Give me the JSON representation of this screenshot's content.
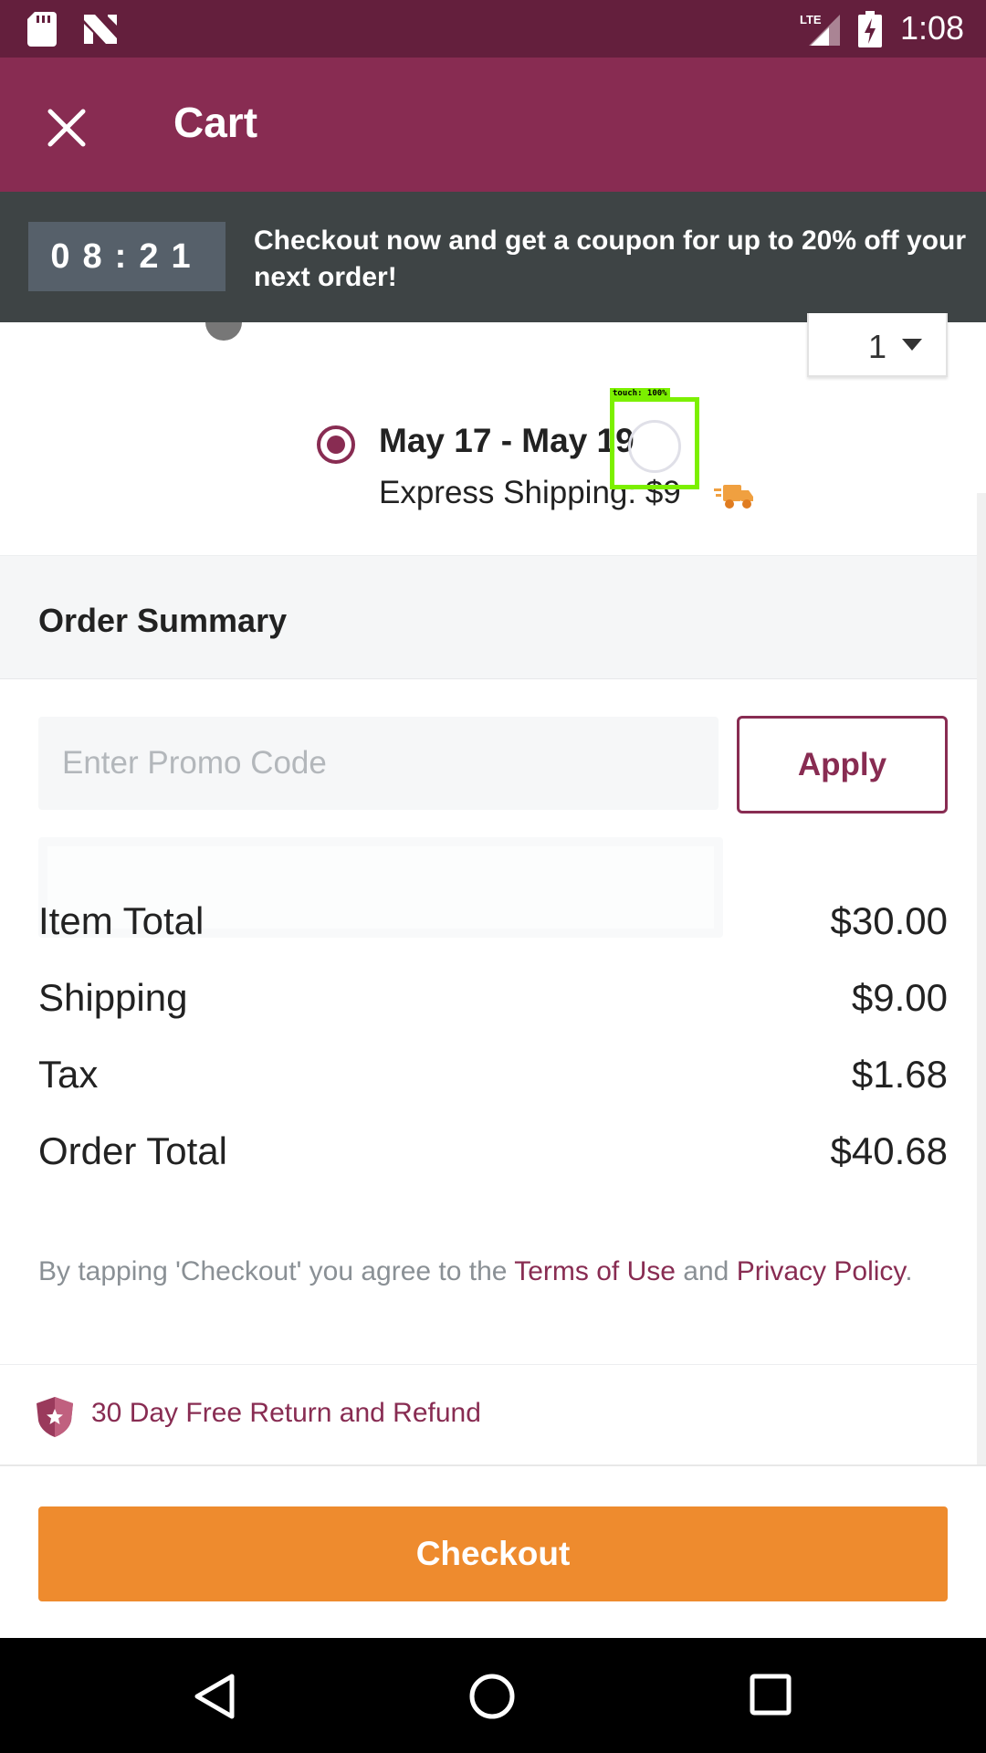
{
  "status_bar": {
    "time": "1:08",
    "network": "LTE",
    "icons": [
      "sd-card-icon",
      "notification-n-icon",
      "lte-signal-icon",
      "battery-charging-icon"
    ]
  },
  "app_bar": {
    "title": "Cart",
    "close_icon": "close-icon"
  },
  "promo_banner": {
    "timer": "08:21",
    "message": "Checkout now and get a coupon for up to 20% off your next order!"
  },
  "product": {
    "quantity": "1"
  },
  "shipping": {
    "dates": "May 17 - May 19",
    "method": "Express Shipping: $9",
    "selected": true
  },
  "touch_overlay": {
    "label": "touch: 100%"
  },
  "order_summary": {
    "title": "Order Summary",
    "promo_placeholder": "Enter Promo Code",
    "apply_label": "Apply",
    "rows": [
      {
        "label": "Item Total",
        "value": "$30.00"
      },
      {
        "label": "Shipping",
        "value": "$9.00"
      },
      {
        "label": "Tax",
        "value": "$1.68"
      },
      {
        "label": "Order Total",
        "value": "$40.68"
      }
    ]
  },
  "terms": {
    "prefix": "By tapping 'Checkout' you agree to the ",
    "terms_link": "Terms of Use",
    "middle": " and ",
    "privacy_link": "Privacy Policy",
    "suffix": "."
  },
  "return_policy": {
    "text": "30 Day Free Return and Refund"
  },
  "checkout": {
    "label": "Checkout"
  },
  "colors": {
    "status_bar": "#641f3d",
    "app_bar": "#882c52",
    "banner": "#3e4445",
    "checkout_button": "#ee8b2e",
    "accent": "#882c52"
  }
}
